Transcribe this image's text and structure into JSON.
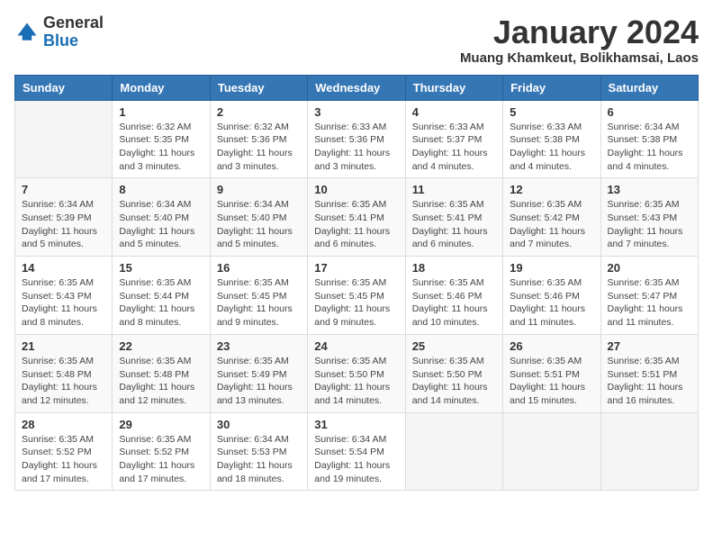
{
  "logo": {
    "general": "General",
    "blue": "Blue"
  },
  "title": "January 2024",
  "subtitle": "Muang Khamkeut, Bolikhamsai, Laos",
  "days_of_week": [
    "Sunday",
    "Monday",
    "Tuesday",
    "Wednesday",
    "Thursday",
    "Friday",
    "Saturday"
  ],
  "weeks": [
    [
      {
        "day": "",
        "info": ""
      },
      {
        "day": "1",
        "info": "Sunrise: 6:32 AM\nSunset: 5:35 PM\nDaylight: 11 hours\nand 3 minutes."
      },
      {
        "day": "2",
        "info": "Sunrise: 6:32 AM\nSunset: 5:36 PM\nDaylight: 11 hours\nand 3 minutes."
      },
      {
        "day": "3",
        "info": "Sunrise: 6:33 AM\nSunset: 5:36 PM\nDaylight: 11 hours\nand 3 minutes."
      },
      {
        "day": "4",
        "info": "Sunrise: 6:33 AM\nSunset: 5:37 PM\nDaylight: 11 hours\nand 4 minutes."
      },
      {
        "day": "5",
        "info": "Sunrise: 6:33 AM\nSunset: 5:38 PM\nDaylight: 11 hours\nand 4 minutes."
      },
      {
        "day": "6",
        "info": "Sunrise: 6:34 AM\nSunset: 5:38 PM\nDaylight: 11 hours\nand 4 minutes."
      }
    ],
    [
      {
        "day": "7",
        "info": "Sunrise: 6:34 AM\nSunset: 5:39 PM\nDaylight: 11 hours\nand 5 minutes."
      },
      {
        "day": "8",
        "info": "Sunrise: 6:34 AM\nSunset: 5:40 PM\nDaylight: 11 hours\nand 5 minutes."
      },
      {
        "day": "9",
        "info": "Sunrise: 6:34 AM\nSunset: 5:40 PM\nDaylight: 11 hours\nand 5 minutes."
      },
      {
        "day": "10",
        "info": "Sunrise: 6:35 AM\nSunset: 5:41 PM\nDaylight: 11 hours\nand 6 minutes."
      },
      {
        "day": "11",
        "info": "Sunrise: 6:35 AM\nSunset: 5:41 PM\nDaylight: 11 hours\nand 6 minutes."
      },
      {
        "day": "12",
        "info": "Sunrise: 6:35 AM\nSunset: 5:42 PM\nDaylight: 11 hours\nand 7 minutes."
      },
      {
        "day": "13",
        "info": "Sunrise: 6:35 AM\nSunset: 5:43 PM\nDaylight: 11 hours\nand 7 minutes."
      }
    ],
    [
      {
        "day": "14",
        "info": "Sunrise: 6:35 AM\nSunset: 5:43 PM\nDaylight: 11 hours\nand 8 minutes."
      },
      {
        "day": "15",
        "info": "Sunrise: 6:35 AM\nSunset: 5:44 PM\nDaylight: 11 hours\nand 8 minutes."
      },
      {
        "day": "16",
        "info": "Sunrise: 6:35 AM\nSunset: 5:45 PM\nDaylight: 11 hours\nand 9 minutes."
      },
      {
        "day": "17",
        "info": "Sunrise: 6:35 AM\nSunset: 5:45 PM\nDaylight: 11 hours\nand 9 minutes."
      },
      {
        "day": "18",
        "info": "Sunrise: 6:35 AM\nSunset: 5:46 PM\nDaylight: 11 hours\nand 10 minutes."
      },
      {
        "day": "19",
        "info": "Sunrise: 6:35 AM\nSunset: 5:46 PM\nDaylight: 11 hours\nand 11 minutes."
      },
      {
        "day": "20",
        "info": "Sunrise: 6:35 AM\nSunset: 5:47 PM\nDaylight: 11 hours\nand 11 minutes."
      }
    ],
    [
      {
        "day": "21",
        "info": "Sunrise: 6:35 AM\nSunset: 5:48 PM\nDaylight: 11 hours\nand 12 minutes."
      },
      {
        "day": "22",
        "info": "Sunrise: 6:35 AM\nSunset: 5:48 PM\nDaylight: 11 hours\nand 12 minutes."
      },
      {
        "day": "23",
        "info": "Sunrise: 6:35 AM\nSunset: 5:49 PM\nDaylight: 11 hours\nand 13 minutes."
      },
      {
        "day": "24",
        "info": "Sunrise: 6:35 AM\nSunset: 5:50 PM\nDaylight: 11 hours\nand 14 minutes."
      },
      {
        "day": "25",
        "info": "Sunrise: 6:35 AM\nSunset: 5:50 PM\nDaylight: 11 hours\nand 14 minutes."
      },
      {
        "day": "26",
        "info": "Sunrise: 6:35 AM\nSunset: 5:51 PM\nDaylight: 11 hours\nand 15 minutes."
      },
      {
        "day": "27",
        "info": "Sunrise: 6:35 AM\nSunset: 5:51 PM\nDaylight: 11 hours\nand 16 minutes."
      }
    ],
    [
      {
        "day": "28",
        "info": "Sunrise: 6:35 AM\nSunset: 5:52 PM\nDaylight: 11 hours\nand 17 minutes."
      },
      {
        "day": "29",
        "info": "Sunrise: 6:35 AM\nSunset: 5:52 PM\nDaylight: 11 hours\nand 17 minutes."
      },
      {
        "day": "30",
        "info": "Sunrise: 6:34 AM\nSunset: 5:53 PM\nDaylight: 11 hours\nand 18 minutes."
      },
      {
        "day": "31",
        "info": "Sunrise: 6:34 AM\nSunset: 5:54 PM\nDaylight: 11 hours\nand 19 minutes."
      },
      {
        "day": "",
        "info": ""
      },
      {
        "day": "",
        "info": ""
      },
      {
        "day": "",
        "info": ""
      }
    ]
  ]
}
